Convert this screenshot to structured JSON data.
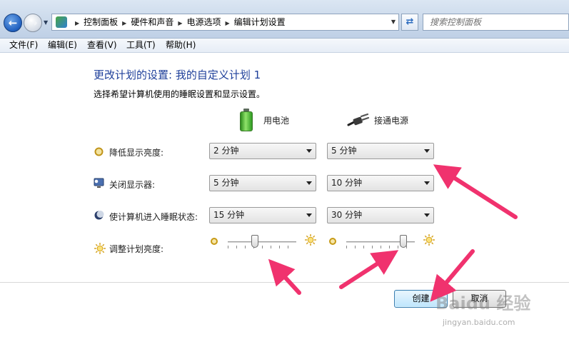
{
  "breadcrumb": [
    "控制面板",
    "硬件和声音",
    "电源选项",
    "编辑计划设置"
  ],
  "search": {
    "placeholder": "搜索控制面板"
  },
  "menu": [
    "文件(F)",
    "编辑(E)",
    "查看(V)",
    "工具(T)",
    "帮助(H)"
  ],
  "page": {
    "title": "更改计划的设置: 我的自定义计划 1",
    "subtitle": "选择希望计算机使用的睡眠设置和显示设置。"
  },
  "columns": {
    "battery": "用电池",
    "plugged": "接通电源"
  },
  "rows": [
    {
      "label": "降低显示亮度:",
      "icon": "dim-brightness-icon",
      "battery": "2 分钟",
      "plugged": "5 分钟"
    },
    {
      "label": "关闭显示器:",
      "icon": "monitor-off-icon",
      "battery": "5 分钟",
      "plugged": "10 分钟"
    },
    {
      "label": "使计算机进入睡眠状态:",
      "icon": "sleep-moon-icon",
      "battery": "15 分钟",
      "plugged": "30 分钟"
    }
  ],
  "brightness": {
    "label": "调整计划亮度:",
    "battery_level": 0.4,
    "plugged_level": 0.83
  },
  "buttons": {
    "create": "创建",
    "cancel": "取消"
  },
  "watermark": {
    "brand": "Baidu 经验",
    "url": "jingyan.baidu.com"
  },
  "colors": {
    "title": "#1e3f9a",
    "annotation_arrow": "#f0326e"
  }
}
